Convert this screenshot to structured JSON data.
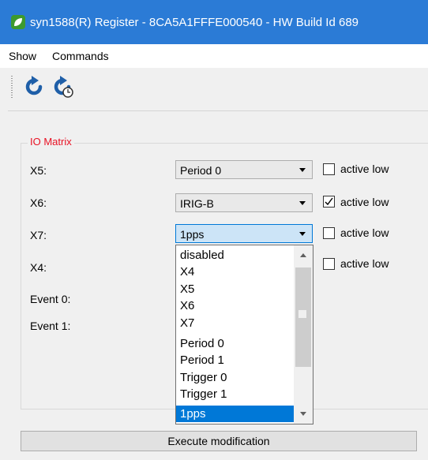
{
  "window": {
    "title": "syn1588(R) Register - 8CA5A1FFFE000540 - HW Build Id 689"
  },
  "menu": {
    "items": [
      "Show",
      "Commands"
    ]
  },
  "toolbar": {
    "buttons": [
      "refresh-icon",
      "auto-refresh-icon"
    ]
  },
  "io_matrix": {
    "title": "IO Matrix",
    "rows": [
      {
        "label": "X5:",
        "value": "Period 0",
        "active_low_label": "active low",
        "active_low": false
      },
      {
        "label": "X6:",
        "value": "IRIG-B",
        "active_low_label": "active low",
        "active_low": true
      },
      {
        "label": "X7:",
        "value": "1pps",
        "active_low_label": "active low",
        "active_low": false
      },
      {
        "label": "X4:",
        "value": "",
        "active_low_label": "active low",
        "active_low": false
      },
      {
        "label": "Event 0:"
      },
      {
        "label": "Event 1:"
      }
    ]
  },
  "dropdown": {
    "options": [
      "disabled",
      "X4",
      "X5",
      "X6",
      "X7",
      "Period 0",
      "Period 1",
      "Trigger 0",
      "Trigger 1",
      "1pps"
    ],
    "selected": "1pps"
  },
  "execute": {
    "label": "Execute modification"
  },
  "colors": {
    "titlebar": "#2b7bd6",
    "group_title": "#e81123",
    "selection": "#0078d7"
  }
}
